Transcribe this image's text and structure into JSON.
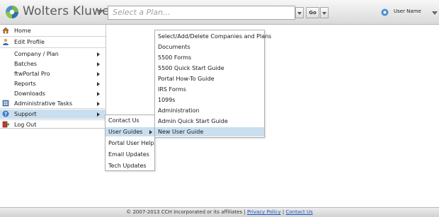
{
  "header": {
    "brand": "Wolters Kluwer",
    "plan_placeholder": "Select a Plan...",
    "go_label": "Go",
    "user_name": "User Name"
  },
  "main_menu": {
    "items": [
      {
        "label": "Home",
        "icon": "home-icon"
      },
      {
        "label": "Edit Profile",
        "icon": "user-icon"
      },
      {
        "label": "Company / Plan"
      },
      {
        "label": "Batches"
      },
      {
        "label": "ftwPortal Pro"
      },
      {
        "label": "Reports"
      },
      {
        "label": "Downloads"
      },
      {
        "label": "Administrative Tasks",
        "icon": "admin-icon"
      },
      {
        "label": "Support",
        "icon": "help-icon"
      },
      {
        "label": "Log Out",
        "icon": "logout-icon"
      }
    ]
  },
  "support_menu": {
    "items": [
      "Contact Us",
      "User Guides",
      "Portal User Help",
      "Email Updates",
      "Tech Updates"
    ]
  },
  "user_guides_menu": {
    "items": [
      "Select/Add/Delete Companies and Plans",
      "Documents",
      "5500 Forms",
      "5500 Quick Start Guide",
      "Portal How-To Guide",
      "IRS Forms",
      "1099s",
      "Administration",
      "Admin Quick Start Guide",
      "New User Guide"
    ]
  },
  "footer": {
    "copyright": "© 2007-2013 CCH Incorporated or its affiliates",
    "separator": "|",
    "privacy_link": "Privacy Policy",
    "contact_link": "Contact Us"
  },
  "colors": {
    "highlight": "#c9dff0",
    "link": "#1a56c7",
    "header_bg": "#e6e6e6"
  }
}
